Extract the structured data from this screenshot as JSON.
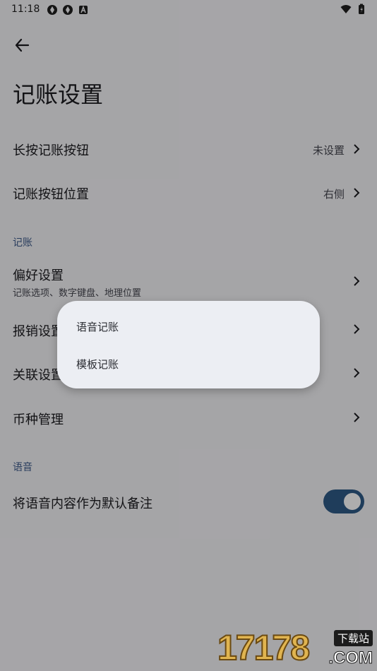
{
  "status_bar": {
    "time": "11:18"
  },
  "page": {
    "title": "记账设置"
  },
  "rows": {
    "long_press": {
      "label": "长按记账按钮",
      "value": "未设置"
    },
    "button_position": {
      "label": "记账按钮位置",
      "value": "右侧"
    },
    "section_bookkeeping": "记账",
    "preferences": {
      "label": "偏好设置",
      "subtitle": "记账选项、数字键盘、地理位置"
    },
    "reimbursement": {
      "label": "报销设置"
    },
    "linked": {
      "label": "关联设置"
    },
    "currency": {
      "label": "币种管理"
    },
    "section_voice": "语音",
    "voice_note": {
      "label": "将语音内容作为默认备注",
      "toggle_on": true
    }
  },
  "menu": {
    "items": [
      "语音记账",
      "模板记账"
    ]
  },
  "watermark": {
    "digits": "17178",
    "badge": "下载站",
    "domain": ".COM"
  },
  "colors": {
    "accent": "#2f5a86",
    "section_header": "#3d5a8a",
    "background": "#f4f3f7",
    "menu_background": "#eceef3"
  }
}
